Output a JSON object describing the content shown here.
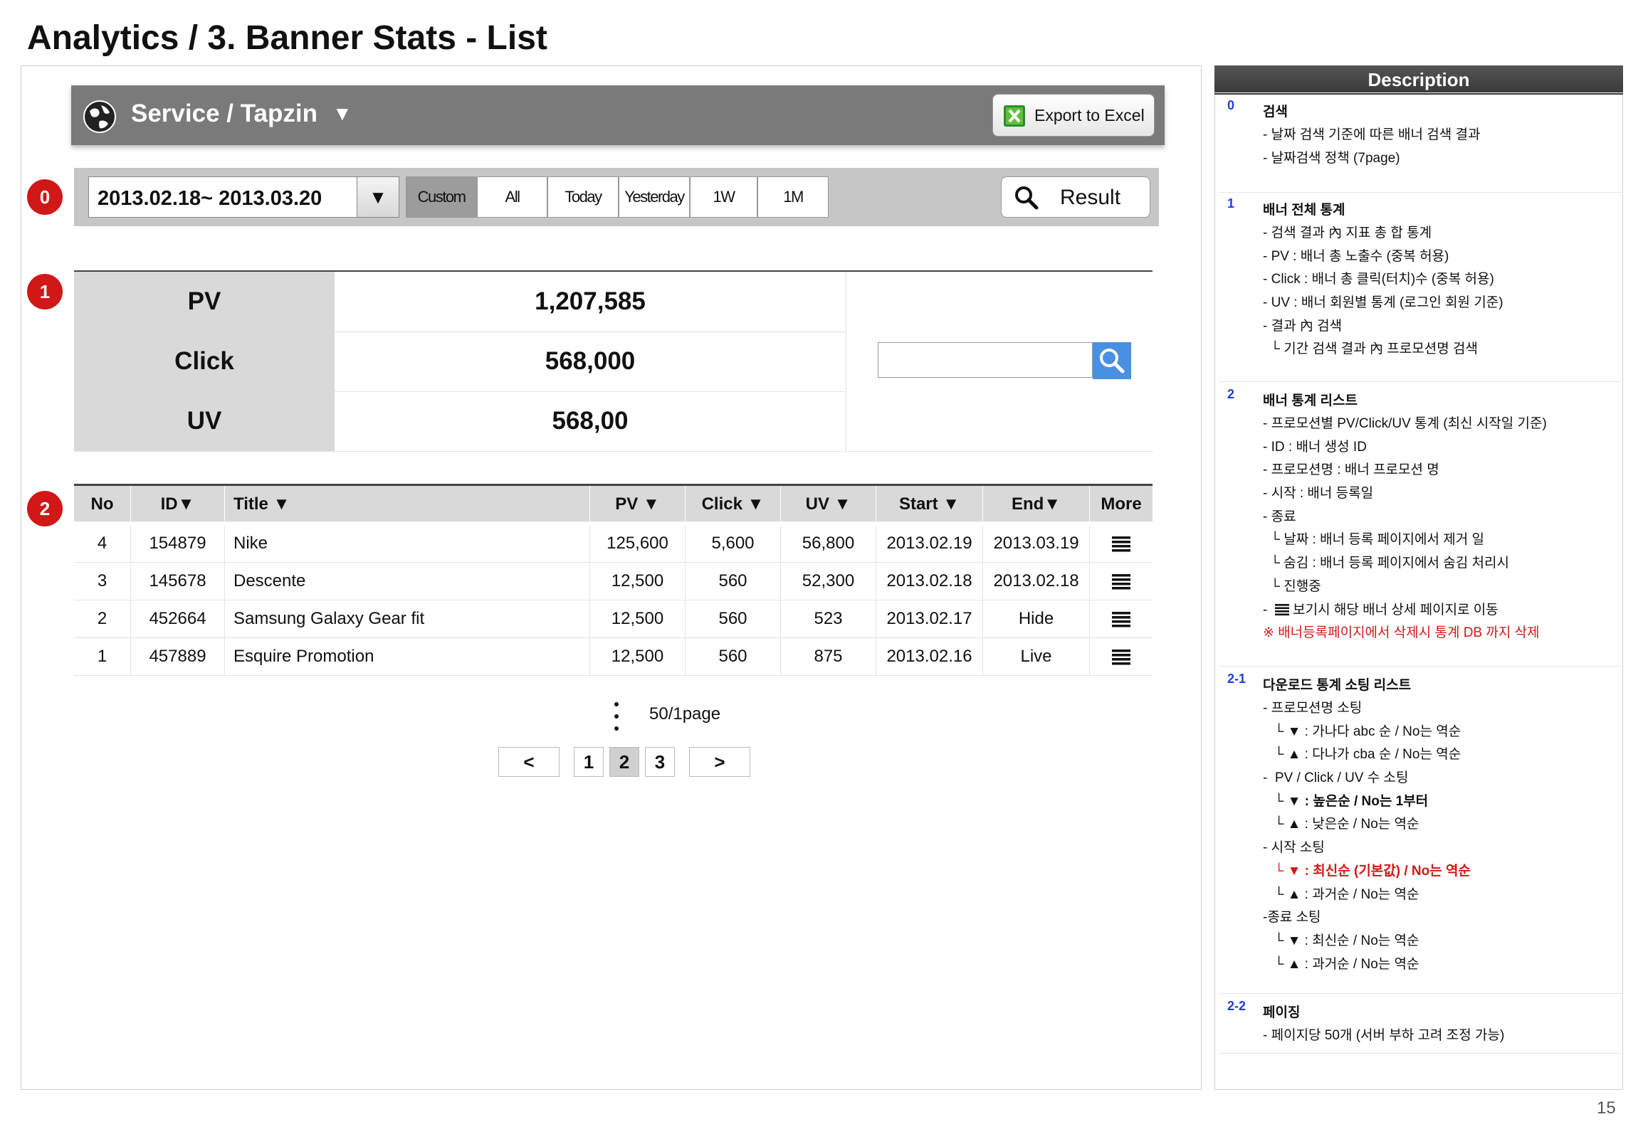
{
  "page_title": "Analytics / 3. Banner Stats - List",
  "header": {
    "service_title": "Service / Tapzin",
    "service_caret": "▼",
    "export_label": "Export to Excel"
  },
  "markers": {
    "m0": "0",
    "m1": "1",
    "m2": "2"
  },
  "search": {
    "date_range": "2013.02.18~ 2013.03.20",
    "date_dropdown": "▼",
    "presets": [
      "Custom",
      "All",
      "Today",
      "Yesterday",
      "1W",
      "1M"
    ],
    "active_preset": "Custom",
    "result_label": "Result"
  },
  "summary": [
    {
      "label": "PV",
      "value": "1,207,585"
    },
    {
      "label": "Click",
      "value": "568,000"
    },
    {
      "label": "UV",
      "value": "568,00"
    }
  ],
  "table": {
    "headers": [
      "No",
      "ID▼",
      "Title ▼",
      "PV ▼",
      "Click ▼",
      "UV ▼",
      "Start ▼",
      "End▼",
      "More"
    ],
    "rows": [
      {
        "no": "4",
        "id": "154879",
        "title": "Nike",
        "pv": "125,600",
        "click": "5,600",
        "uv": "56,800",
        "start": "2013.02.19",
        "end": "2013.03.19"
      },
      {
        "no": "3",
        "id": "145678",
        "title": "Descente",
        "pv": "12,500",
        "click": "560",
        "uv": "52,300",
        "start": "2013.02.18",
        "end": "2013.02.18"
      },
      {
        "no": "2",
        "id": "452664",
        "title": "Samsung Galaxy Gear fit",
        "pv": "12,500",
        "click": "560",
        "uv": "523",
        "start": "2013.02.17",
        "end": "Hide"
      },
      {
        "no": "1",
        "id": "457889",
        "title": "Esquire Promotion",
        "pv": "12,500",
        "click": "560",
        "uv": "875",
        "start": "2013.02.16",
        "end": "Live"
      }
    ]
  },
  "pagination": {
    "per_page": "50/1page",
    "prev": "<",
    "next": ">",
    "pages": [
      "1",
      "2",
      "3"
    ],
    "current": "2"
  },
  "description": {
    "heading": "Description",
    "sections": [
      {
        "num": "0",
        "title": "검색",
        "lines": [
          {
            "t": "- 날짜 검색 기준에 따른 배너 검색 결과"
          },
          {
            "t": "- 날짜검색 정책 (7page)"
          }
        ]
      },
      {
        "num": "1",
        "title": "배너 전체 통계",
        "lines": [
          {
            "t": "- 검색 결과 內 지표 총 합 통계"
          },
          {
            "t": "- PV : 배너 총 노출수 (중복 허용)"
          },
          {
            "t": "- Click : 배너 총 클릭(터치)수 (중복 허용)"
          },
          {
            "t": "- UV : 배너 회원별 통계 (로그인 회원 기준)"
          },
          {
            "t": "- 결과 內 검색"
          },
          {
            "t": "  └ 기간 검색 결과 內 프로모션명 검색"
          }
        ]
      },
      {
        "num": "2",
        "title": "배너 통계 리스트",
        "lines": [
          {
            "t": "- 프로모션별 PV/Click/UV 통계 (최신 시작일 기준)"
          },
          {
            "t": "- ID : 배너 생성 ID"
          },
          {
            "t": "- 프로모션명 : 배너 프로모션 명"
          },
          {
            "t": "- 시작 : 배너 등록일"
          },
          {
            "t": "- 종료"
          },
          {
            "t": "  └ 날짜 : 배너 등록 페이지에서 제거 일"
          },
          {
            "t": "  └ 숨김 : 배너 등록 페이지에서 숨김 처리시"
          },
          {
            "t": "  └ 진행중"
          },
          {
            "t": "- ",
            "icon": "menu-icon",
            "after": " 보기시 해당 배너 상세 페이지로 이동"
          },
          {
            "t": "※ 배너등록페이지에서 삭제시 통계 DB 까지 삭제",
            "style": "red"
          }
        ]
      },
      {
        "num": "2-1",
        "title": "다운로드 통계 소팅 리스트",
        "lines": [
          {
            "t": "- 프로모션명 소팅"
          },
          {
            "t": "   └ ▼ : 가나다 abc 순 / No는 역순"
          },
          {
            "t": "   └ ▲ : 다나가 cba 순 / No는 역순"
          },
          {
            "t": "-  PV / Click / UV 수 소팅"
          },
          {
            "t": "   └ ▼ : 높은순 / No는 1부터",
            "style": "bold"
          },
          {
            "t": "   └ ▲ : 낮은순 / No는 역순"
          },
          {
            "t": "- 시작 소팅"
          },
          {
            "t": "   └ ▼ : 최신순 (기본값) / No는 역순",
            "style": "boldred"
          },
          {
            "t": "   └ ▲ : 과거순 / No는 역순"
          },
          {
            "t": "-종료 소팅"
          },
          {
            "t": "   └ ▼ : 최신순 / No는 역순"
          },
          {
            "t": "   └ ▲ : 과거순 / No는 역순"
          }
        ]
      },
      {
        "num": "2-2",
        "title": "페이징",
        "lines": [
          {
            "t": "- 페이지당 50개 (서버 부하 고려 조정 가능)"
          }
        ]
      }
    ]
  },
  "page_number": "15",
  "colors": {
    "marker": "#d01818",
    "bar": "#7a7a7a",
    "search_btn": "#4a90e2",
    "desc_num": "#1f3ed8",
    "alert": "#d01818"
  }
}
